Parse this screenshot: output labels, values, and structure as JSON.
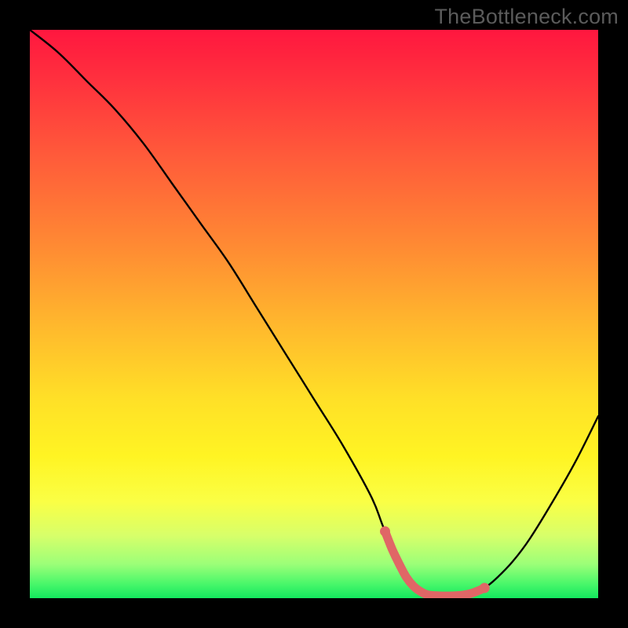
{
  "watermark": {
    "text": "TheBottleneck.com"
  },
  "colors": {
    "background": "#000000",
    "curve_stroke": "#000000",
    "highlight": "#e06666"
  },
  "chart_data": {
    "type": "line",
    "title": "",
    "xlabel": "",
    "ylabel": "",
    "xlim": [
      0,
      100
    ],
    "ylim": [
      0,
      100
    ],
    "grid": false,
    "series": [
      {
        "name": "curve",
        "x": [
          0,
          5,
          10,
          15,
          20,
          25,
          30,
          35,
          40,
          45,
          50,
          55,
          60,
          62,
          64,
          66,
          68,
          70,
          72,
          74,
          76,
          78,
          80,
          82,
          85,
          88,
          92,
          96,
          100
        ],
        "y": [
          100,
          96,
          91,
          86,
          80,
          73,
          66,
          59,
          51,
          43,
          35,
          27,
          18,
          13,
          8,
          4,
          1.5,
          0.6,
          0.4,
          0.4,
          0.5,
          0.9,
          1.8,
          3.4,
          6.5,
          10.5,
          17,
          24,
          32
        ]
      }
    ],
    "highlight_range": {
      "x_start": 62.5,
      "x_end": 80
    }
  }
}
